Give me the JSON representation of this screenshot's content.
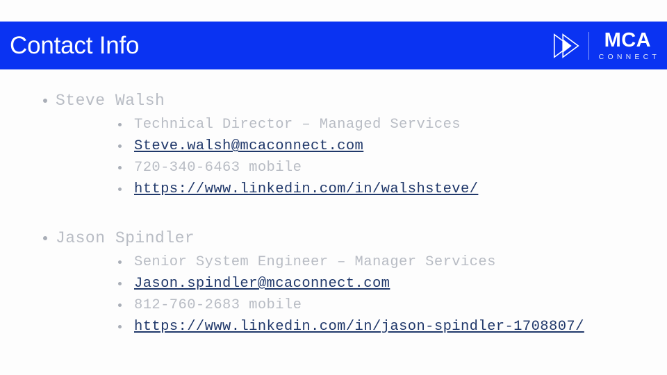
{
  "slide": {
    "title": "Contact Info",
    "band_color": "#0a33f2",
    "body_text_color": "#b8bcc4",
    "link_color": "#20386a"
  },
  "logo": {
    "mark_name": "mca-connect-triangles-icon",
    "brand": "MCA",
    "tagline": "CONNECT"
  },
  "contacts": [
    {
      "name": "Steve Walsh",
      "details": [
        {
          "text": "Technical Director – Managed Services",
          "kind": "plain"
        },
        {
          "text": "Steve.walsh@mcaconnect.com",
          "kind": "link"
        },
        {
          "text": "720-340-6463 mobile",
          "kind": "plain"
        },
        {
          "text": "https://www.linkedin.com/in/walshsteve/",
          "kind": "link"
        }
      ]
    },
    {
      "name": "Jason Spindler",
      "details": [
        {
          "text": "Senior System Engineer – Manager Services",
          "kind": "plain"
        },
        {
          "text": "Jason.spindler@mcaconnect.com",
          "kind": "link"
        },
        {
          "text": "812-760-2683 mobile",
          "kind": "plain"
        },
        {
          "text": "https://www.linkedin.com/in/jason-spindler-1708807/",
          "kind": "link"
        }
      ]
    }
  ]
}
